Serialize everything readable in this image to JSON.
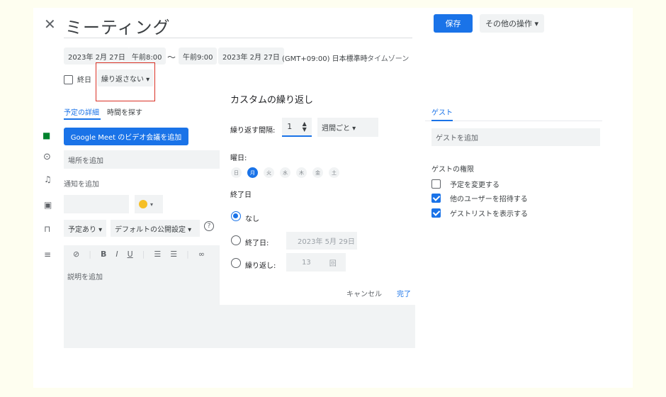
{
  "header": {
    "close_icon": "close-icon",
    "title": "ミーティング",
    "save_label": "保存",
    "more_actions_label": "その他の操作 ▾"
  },
  "datetime": {
    "start_date": "2023年 2月 27日",
    "start_time": "午前8:00",
    "separator": "〜",
    "end_time": "午前9:00",
    "end_date": "2023年 2月 27日",
    "timezone": "(GMT+09:00) 日本標準時",
    "timezone_link": "タイムゾーン"
  },
  "options": {
    "all_day_label": "終日",
    "repeat_value": "繰り返さない ▾"
  },
  "tabs": [
    "予定の詳細",
    "時間を探す"
  ],
  "details": {
    "meet_button": "Google Meet のビデオ会議を追加",
    "location_placeholder": "場所を追加",
    "notification_label": "通知を追加",
    "busy_label": "予定あり ▾",
    "visibility_label": "デフォルトの公開設定 ▾",
    "help_icon": "?",
    "description_placeholder": "説明を追加",
    "color_dot": "#f6bf26",
    "toolbar": [
      "B",
      "I",
      "U"
    ]
  },
  "recurrence": {
    "title": "カスタムの繰り返し",
    "interval_label": "繰り返す間隔:",
    "interval_value": "1",
    "interval_unit": "週間ごと ▾",
    "weekday_label": "曜日:",
    "days": [
      "日",
      "月",
      "火",
      "水",
      "木",
      "金",
      "土"
    ],
    "selected_day_index": 1,
    "end_label": "終了日",
    "never": "なし",
    "on_date_label": "終了日:",
    "on_date_value": "2023年 5月 29日",
    "after_label": "繰り返し:",
    "after_value": "13",
    "after_unit": "回",
    "cancel": "キャンセル",
    "done": "完了"
  },
  "guests": {
    "tab": "ゲスト",
    "add_placeholder": "ゲストを追加",
    "permissions_title": "ゲストの権限",
    "permissions": [
      {
        "label": "予定を変更する",
        "checked": false
      },
      {
        "label": "他のユーザーを招待する",
        "checked": true
      },
      {
        "label": "ゲストリストを表示する",
        "checked": true
      }
    ]
  },
  "colors": {
    "accent": "#1a73e8",
    "highlight_border": "#d93025"
  }
}
